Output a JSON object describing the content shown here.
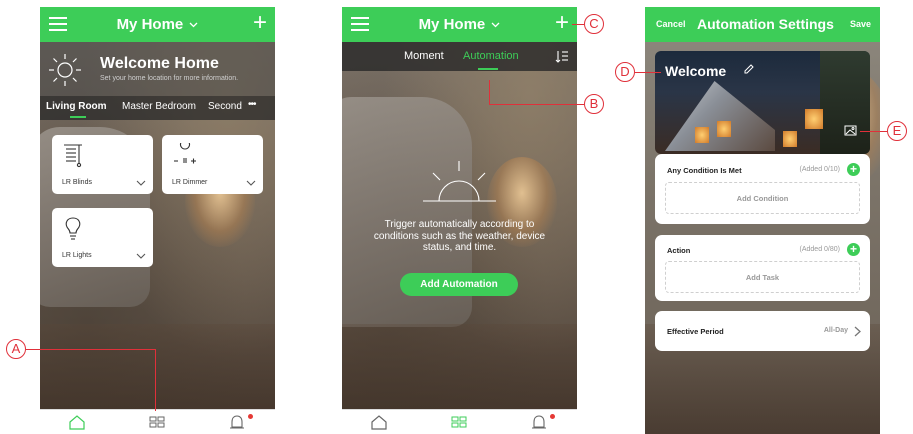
{
  "screen1": {
    "title": "My Home",
    "welcome": {
      "title": "Welcome Home",
      "subtitle": "Set your home location for more information."
    },
    "rooms": [
      "Living Room",
      "Master Bedroom",
      "Second"
    ],
    "more": "•••",
    "devices": [
      {
        "label": "LR Blinds",
        "icon": "blinds-icon"
      },
      {
        "label": "LR Dimmer",
        "icon": "dimmer-icon"
      },
      {
        "label": "LR Lights",
        "icon": "bulb-icon"
      }
    ]
  },
  "screen2": {
    "title": "My Home",
    "tabs": [
      "Moment",
      "Automation"
    ],
    "message": "Trigger automatically according to conditions such as the weather, device status, and time.",
    "add_button": "Add Automation"
  },
  "screen3": {
    "cancel": "Cancel",
    "title": "Automation Settings",
    "save": "Save",
    "name": "Welcome",
    "condition": {
      "title": "Any Condition Is Met",
      "count": "(Added 0/10)",
      "placeholder": "Add Condition"
    },
    "action": {
      "title": "Action",
      "count": "(Added 0/80)",
      "placeholder": "Add Task"
    },
    "period": {
      "title": "Effective Period",
      "value": "All-Day"
    }
  },
  "callouts": [
    "A",
    "B",
    "C",
    "D",
    "E"
  ],
  "colors": {
    "accent": "#3dcd58",
    "callout": "#e0303a",
    "badge": "#e53935"
  }
}
